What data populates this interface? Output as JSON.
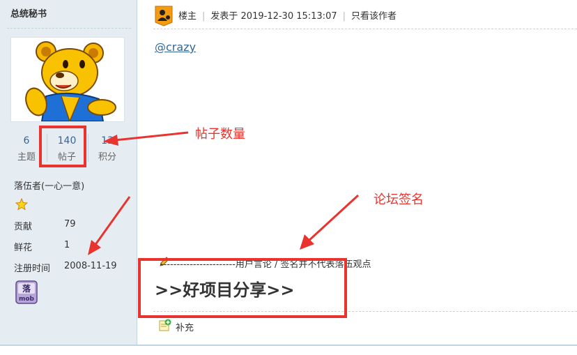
{
  "sidebar": {
    "username": "总统秘书",
    "avatar": "bear-avatar",
    "stats": [
      {
        "value": "6",
        "label": "主题"
      },
      {
        "value": "140",
        "label": "帖子"
      },
      {
        "value": "13",
        "label": "积分"
      }
    ],
    "group": "落伍者(一心一意)",
    "rows": [
      {
        "key": "贡献",
        "value": "79"
      },
      {
        "key": "鲜花",
        "value": "1"
      },
      {
        "key": "注册时间",
        "value": "2008-11-19"
      }
    ],
    "medal_icon": "mob-badge-icon",
    "medal_text": "落mob"
  },
  "post": {
    "author_label": "楼主",
    "posted": "发表于 2019-12-30 15:13:07",
    "only_author": "只看该作者",
    "mention": "@crazy"
  },
  "signature": {
    "disclaimer": "-----------------------用户言论 / 签名并不代表落伍观点",
    "big_text": ">>好项目分享>>"
  },
  "footer": {
    "supplement_label": "补充"
  },
  "annotations": {
    "post_count_label": "帖子数量",
    "signature_label": "论坛签名",
    "color": "#e8332e"
  }
}
